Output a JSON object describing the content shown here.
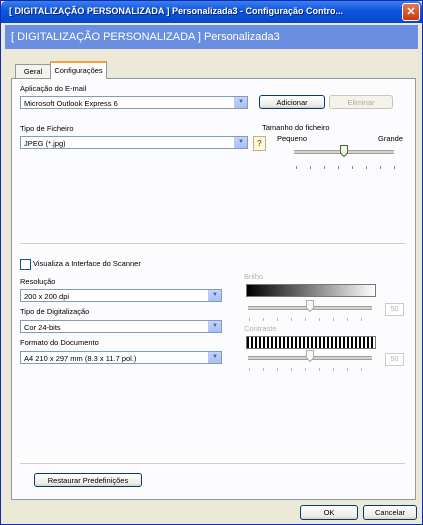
{
  "window": {
    "title": "[ DIGITALIZAÇÃO PERSONALIZADA ]  Personalizada3 - Configuração Contro...",
    "banner": "[ DIGITALIZAÇÃO PERSONALIZADA ]  Personalizada3",
    "close_glyph": "✕"
  },
  "tabs": [
    {
      "label": "Geral",
      "active": false
    },
    {
      "label": "Configurações",
      "active": true
    }
  ],
  "email": {
    "label": "Aplicação do E-mail",
    "value": "Microsoft Outlook Express 6",
    "add_button": "Adicionar",
    "remove_button": "Eliminar"
  },
  "file_type": {
    "label": "Tipo de Ficheiro",
    "value": "JPEG (*.jpg)",
    "help_glyph": "?"
  },
  "file_size": {
    "label": "Tamanho do ficheiro",
    "min_label": "Pequeno",
    "max_label": "Grande",
    "level": 0.5
  },
  "scanner_ui": {
    "label": "Visualiza a Interface do Scanner",
    "checked": false
  },
  "resolution": {
    "label": "Resolução",
    "value": "200 x 200 dpi"
  },
  "scan_type": {
    "label": "Tipo de Digitalização",
    "value": "Cor 24-bits"
  },
  "doc_format": {
    "label": "Formato do Documento",
    "value": "A4 210 x 297 mm (8.3 x 11.7 pol.)"
  },
  "brightness": {
    "label": "Brilho",
    "value": "50"
  },
  "contrast": {
    "label": "Contraste",
    "value": "50"
  },
  "restore_button": "Restaurar Predefinições",
  "ok_button": "OK",
  "cancel_button": "Cancelar",
  "arrow_glyph": "▼",
  "colors": {
    "title_bar": "#0b55df",
    "banner": "#6a8fe0",
    "close": "#c43a12",
    "dialog_bg": "#ece9d8"
  }
}
